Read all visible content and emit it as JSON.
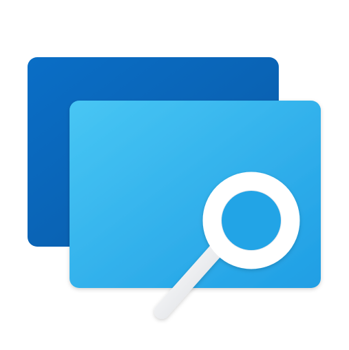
{
  "icon": {
    "name": "windows-explorer-search-icon",
    "colors": {
      "back_window_light": "#0a6ec6",
      "back_window_dark": "#0a5aa6",
      "front_window_light": "#48c6f4",
      "front_window_dark": "#1f9ee4",
      "magnifier_white": "#ffffff",
      "magnifier_gray": "#d8dbe0"
    }
  }
}
